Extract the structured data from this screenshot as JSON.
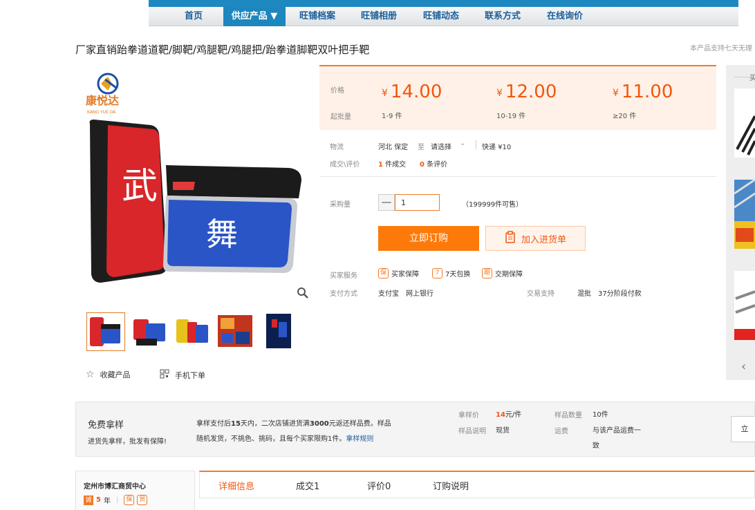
{
  "nav": {
    "items": [
      "首页",
      "供应产品 ▼",
      "旺铺档案",
      "旺铺相册",
      "旺铺动态",
      "联系方式",
      "在线询价"
    ],
    "active_index": 1,
    "accent": "#1d86bd"
  },
  "product": {
    "title": "厂家直销跆拳道道靶/脚靶/鸡腿靶/鸡腿把/跆拳道脚靶双叶把手靶",
    "top_note": "本产品支持七天无理"
  },
  "gallery": {
    "brand_text": "康悦达",
    "brand_sub": "KANG YUE DA",
    "pad_char_red": "武",
    "pad_char_blue": "舞",
    "favorite_label": "收藏产品",
    "mobile_label": "手机下单"
  },
  "price": {
    "label": "价格",
    "min_label": "起批量",
    "currency": "¥",
    "tiers": [
      {
        "price": "14.00",
        "range": "1-9 件"
      },
      {
        "price": "12.00",
        "range": "10-19 件"
      },
      {
        "price": "11.00",
        "range": "≥20 件"
      }
    ],
    "color": "#f2560d"
  },
  "logistics": {
    "label": "物流",
    "origin": "河北 保定",
    "to": "至",
    "select": "请选择",
    "express": "快递 ¥10"
  },
  "deal": {
    "label": "成交\\评价",
    "count": "1",
    "count_unit": "件成交",
    "reviews": "0",
    "reviews_unit": "条评价"
  },
  "purchase": {
    "label": "采购量",
    "minus": "—",
    "quantity": "1",
    "stock": "（199999件可售）",
    "buy_button": "立即订购",
    "cart_button": "加入进货单"
  },
  "service": {
    "label": "买家服务",
    "items": [
      {
        "icon": "保",
        "text": "买家保障"
      },
      {
        "icon": "7",
        "text": "7天包换"
      },
      {
        "icon": "期",
        "text": "交期保障"
      }
    ]
  },
  "payment": {
    "label": "支付方式",
    "methods": "支付宝　网上银行",
    "trade_label": "交易支持",
    "trade_value": "混批　37分阶段付款"
  },
  "recommend": {
    "title": "买"
  },
  "sample": {
    "title": "免费拿样",
    "subtitle": "进货先拿样，批发有保障!",
    "desc_1a": "拿样支付后",
    "desc_1b": "15",
    "desc_1c": "天内，二次店铺进货满",
    "desc_1d": "3000",
    "desc_1e": "元返还样品费。样品",
    "desc_2": "随机发货，不挑色、挑码，且每个买家限购1件。",
    "rule_link": "拿样规则",
    "price_label": "拿样价",
    "price_value": "14",
    "price_unit": "元/件",
    "qty_label": "样品数量",
    "qty_value": "10件",
    "note_label": "样品说明",
    "note_value": "现货",
    "ship_label": "运费",
    "ship_value_1": "与该产品运费一",
    "ship_value_2": "致",
    "button": "立"
  },
  "shop": {
    "name": "定州市博汇商贸中心",
    "badge": "诚",
    "years": "5",
    "years_unit": "年",
    "badges": [
      "保",
      "贸"
    ]
  },
  "tabs": [
    "详细信息",
    "成交1",
    "评价0",
    "订购说明"
  ]
}
